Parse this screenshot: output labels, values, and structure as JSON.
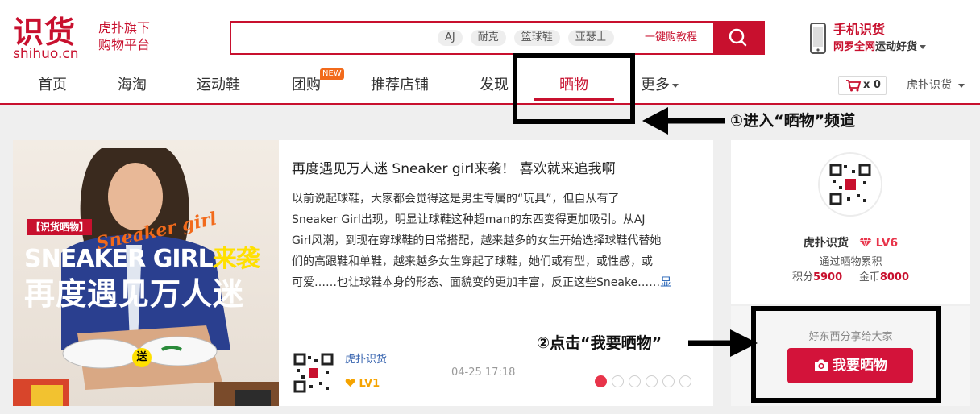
{
  "logo": {
    "name_cn": "识货",
    "name_en": "shihuo.cn"
  },
  "slogan": {
    "line1": "虎扑旗下",
    "line2": "购物平台"
  },
  "search": {
    "placeholder": "",
    "tags": [
      "AJ",
      "耐克",
      "篮球鞋",
      "亚瑟士"
    ],
    "tutorial": "一键购教程"
  },
  "mobile": {
    "title": "手机识货",
    "sub_red": "网罗全网",
    "sub": "运动好货"
  },
  "nav": {
    "items": [
      "首页",
      "海淘",
      "运动鞋",
      "团购",
      "推荐店铺",
      "发现",
      "晒物",
      "更多"
    ],
    "new_badge": "NEW",
    "active": "晒物"
  },
  "cart": {
    "count": "x 0"
  },
  "user_menu": "虎扑识货",
  "annotations": {
    "step1": "①进入“晒物”频道",
    "step2": "②点击“我要晒物”"
  },
  "post": {
    "title": "再度遇见万人迷 Sneaker girl来袭！ 喜欢就来追我啊",
    "body_lines": [
      "以前说起球鞋，大家都会觉得这是男生专属的“玩具”，但自从有了",
      "Sneaker Girl出现，明显让球鞋这种超man的东西变得更加吸引。从AJ",
      "Girl风潮，到现在穿球鞋的日常搭配，越来越多的女生开始选择球鞋代替她",
      "们的高跟鞋和单鞋，越来越多女生穿起了球鞋，她们或有型，或性感，或",
      "可爱……也让球鞋本身的形态、面貌变的更加丰富，反正这些Sneake……"
    ],
    "more_link": "显",
    "cover": {
      "tag": "【识货晒物】",
      "line1_white": "SNEAKER GIRL",
      "line1_yellow": "来袭",
      "line2": "再度遇见万人迷",
      "script": "Sneaker girl",
      "send": "送"
    },
    "author": {
      "name": "虎扑识货",
      "level": "LV1"
    },
    "time": "04-25  17:18",
    "carousel": {
      "count": 6,
      "active_index": 0
    }
  },
  "profile": {
    "name": "虎扑识货",
    "level": "LV6",
    "desc": "通过晒物累积",
    "points_label": "积分",
    "points": "5900",
    "coins_label": "金币",
    "coins": "8000"
  },
  "share": {
    "text": "好东西分享给大家",
    "button": "我要晒物"
  },
  "colors": {
    "brand": "#c8102e",
    "accent": "#d3133a",
    "badge": "#f26a1b"
  }
}
